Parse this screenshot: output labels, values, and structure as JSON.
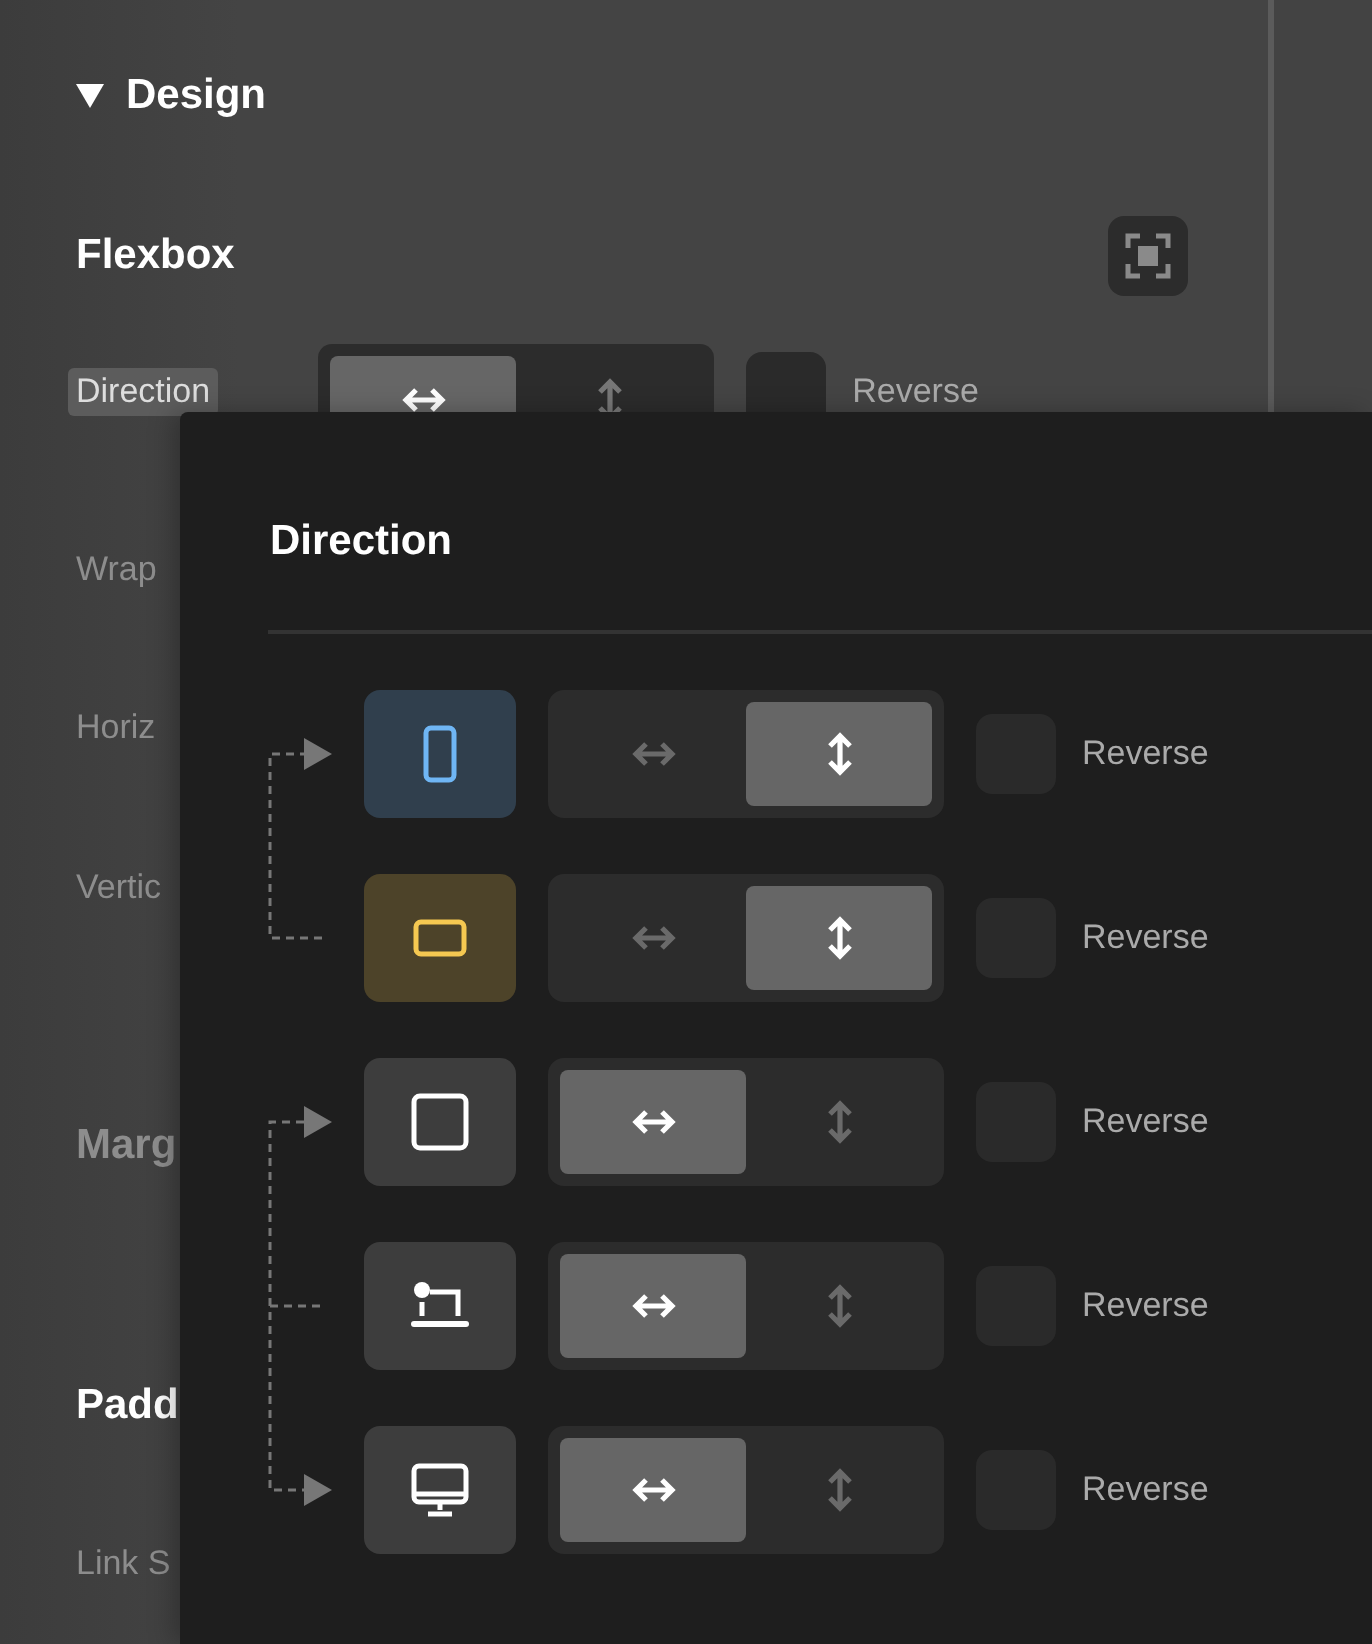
{
  "panel": {
    "section": {
      "title": "Design",
      "expanded": true
    },
    "flexbox": {
      "title": "Flexbox"
    },
    "direction": {
      "label": "Direction",
      "segments": [
        {
          "kind": "horizontal",
          "selected": true
        },
        {
          "kind": "vertical",
          "selected": false
        }
      ],
      "reverse": {
        "label": "Reverse",
        "checked": false
      }
    },
    "labels": [
      {
        "kind": "label",
        "text": "Wrap",
        "dimmed": true
      },
      {
        "kind": "label",
        "text": "Horiz",
        "dimmed": true
      },
      {
        "kind": "label",
        "text": "Vertic",
        "dimmed": true
      },
      {
        "kind": "group",
        "text": "Marg",
        "dimmed": true
      },
      {
        "kind": "group",
        "text": "Padd",
        "dimmed": false
      },
      {
        "kind": "label",
        "text": "Link S",
        "dimmed": true
      }
    ]
  },
  "popover": {
    "title": "Direction",
    "rows": [
      {
        "kind": "phone",
        "color": "#6fb6f5",
        "segments": [
          {
            "kind": "horizontal",
            "selected": false
          },
          {
            "kind": "vertical",
            "selected": true
          }
        ],
        "reverse": {
          "label": "Reverse",
          "checked": false
        }
      },
      {
        "kind": "tablet",
        "color": "#f5c851",
        "segments": [
          {
            "kind": "horizontal",
            "selected": false
          },
          {
            "kind": "vertical",
            "selected": true
          }
        ],
        "reverse": {
          "label": "Reverse",
          "checked": false
        }
      },
      {
        "kind": "square",
        "segments": [
          {
            "kind": "horizontal",
            "selected": true
          },
          {
            "kind": "vertical",
            "selected": false
          }
        ],
        "reverse": {
          "label": "Reverse",
          "checked": false
        }
      },
      {
        "kind": "laptop",
        "segments": [
          {
            "kind": "horizontal",
            "selected": true
          },
          {
            "kind": "vertical",
            "selected": false
          }
        ],
        "reverse": {
          "label": "Reverse",
          "checked": false
        }
      },
      {
        "kind": "desktop",
        "segments": [
          {
            "kind": "horizontal",
            "selected": true
          },
          {
            "kind": "vertical",
            "selected": false
          }
        ],
        "reverse": {
          "label": "Reverse",
          "checked": false
        }
      }
    ]
  }
}
